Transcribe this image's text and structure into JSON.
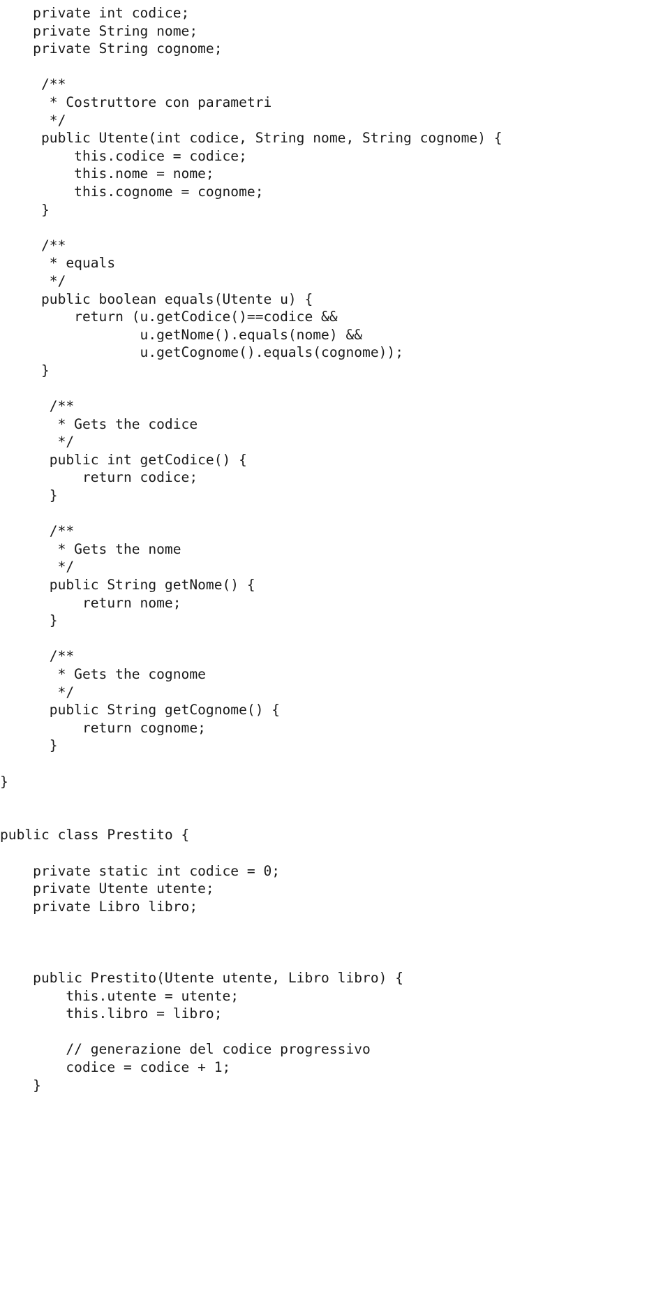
{
  "document": {
    "kind": "source-code-listing",
    "language": "Java",
    "background_color": "#ffffff",
    "text_color": "#1a1a1a"
  },
  "code": {
    "lines": [
      "    private int codice;",
      "    private String nome;",
      "    private String cognome;",
      "",
      "     /**",
      "      * Costruttore con parametri",
      "      */",
      "     public Utente(int codice, String nome, String cognome) {",
      "         this.codice = codice;",
      "         this.nome = nome;",
      "         this.cognome = cognome;",
      "     }",
      "",
      "     /**",
      "      * equals",
      "      */",
      "     public boolean equals(Utente u) {",
      "         return (u.getCodice()==codice &&",
      "                 u.getNome().equals(nome) &&",
      "                 u.getCognome().equals(cognome));",
      "     }",
      "",
      "      /**",
      "       * Gets the codice",
      "       */",
      "      public int getCodice() {",
      "          return codice;",
      "      }",
      "",
      "      /**",
      "       * Gets the nome",
      "       */",
      "      public String getNome() {",
      "          return nome;",
      "      }",
      "",
      "      /**",
      "       * Gets the cognome",
      "       */",
      "      public String getCognome() {",
      "          return cognome;",
      "      }",
      "",
      "}",
      "",
      "",
      "public class Prestito {",
      "",
      "    private static int codice = 0;",
      "    private Utente utente;",
      "    private Libro libro;",
      "",
      "",
      "",
      "    public Prestito(Utente utente, Libro libro) {",
      "        this.utente = utente;",
      "        this.libro = libro;",
      "",
      "        // generazione del codice progressivo",
      "        codice = codice + 1;",
      "    }"
    ]
  }
}
